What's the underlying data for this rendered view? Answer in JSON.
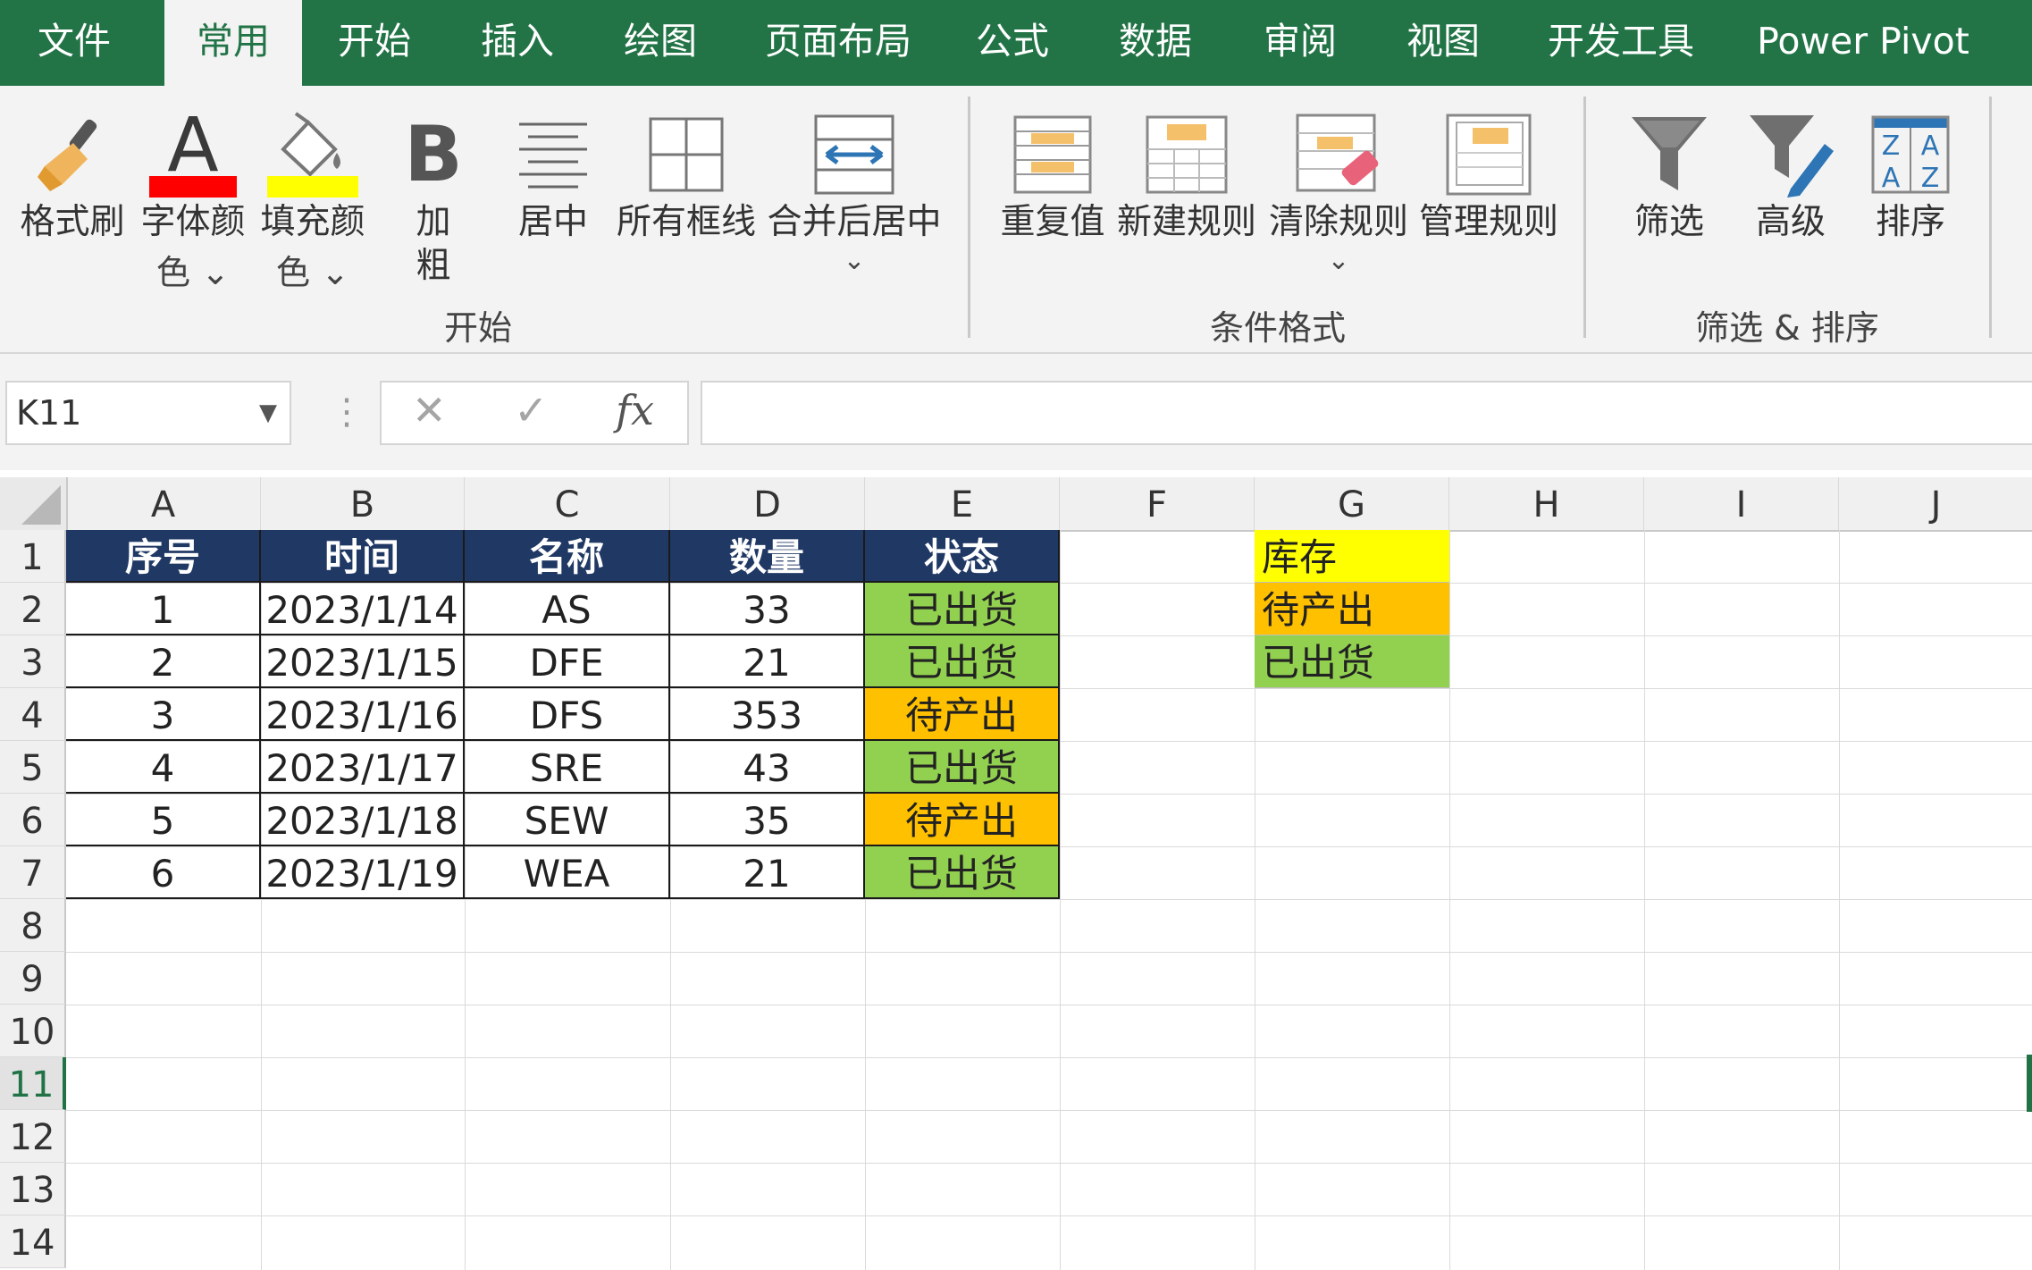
{
  "tabs": [
    "文件",
    "常用",
    "开始",
    "插入",
    "绘图",
    "页面布局",
    "公式",
    "数据",
    "审阅",
    "视图",
    "开发工具",
    "Power Pivot"
  ],
  "active_tab": "常用",
  "ribbon": {
    "format_painter": "格式刷",
    "font_color_1": "字体颜",
    "font_color_2": "色",
    "fill_color_1": "填充颜",
    "fill_color_2": "色",
    "bold_1": "加",
    "bold_2": "粗",
    "center": "居中",
    "all_borders": "所有框线",
    "merge_center": "合并后居中",
    "group_start": "开始",
    "duplicate": "重复值",
    "new_rule": "新建规则",
    "clear_rules": "清除规则",
    "manage_rules": "管理规则",
    "group_conditional": "条件格式",
    "filter": "筛选",
    "advanced": "高级",
    "sort": "排序",
    "group_filter_sort": "筛选 & 排序"
  },
  "colors": {
    "accent_green": "#227447",
    "font_color_bar": "#ff0000",
    "fill_color_bar": "#ffff00",
    "header_fill": "#203864",
    "shipped_fill": "#92d050",
    "pending_fill": "#ffc000",
    "stock_fill": "#ffff00"
  },
  "formula_bar": {
    "name_box": "K11",
    "cancel": "✕",
    "enter": "✓",
    "fx": "fx",
    "formula": ""
  },
  "columns": [
    "A",
    "B",
    "C",
    "D",
    "E",
    "F",
    "G",
    "H",
    "I",
    "J"
  ],
  "rows": [
    "1",
    "2",
    "3",
    "4",
    "5",
    "6",
    "7",
    "8",
    "9",
    "10",
    "11",
    "12",
    "13",
    "14"
  ],
  "selected_row": "11",
  "table": {
    "headers": [
      "序号",
      "时间",
      "名称",
      "数量",
      "状态"
    ],
    "rows": [
      {
        "no": "1",
        "date": "2023/1/14",
        "name": "AS",
        "qty": "33",
        "status": "已出货"
      },
      {
        "no": "2",
        "date": "2023/1/15",
        "name": "DFE",
        "qty": "21",
        "status": "已出货"
      },
      {
        "no": "3",
        "date": "2023/1/16",
        "name": "DFS",
        "qty": "353",
        "status": "待产出"
      },
      {
        "no": "4",
        "date": "2023/1/17",
        "name": "SRE",
        "qty": "43",
        "status": "已出货"
      },
      {
        "no": "5",
        "date": "2023/1/18",
        "name": "SEW",
        "qty": "35",
        "status": "待产出"
      },
      {
        "no": "6",
        "date": "2023/1/19",
        "name": "WEA",
        "qty": "21",
        "status": "已出货"
      }
    ]
  },
  "legend_list": [
    "库存",
    "待产出",
    "已出货"
  ]
}
